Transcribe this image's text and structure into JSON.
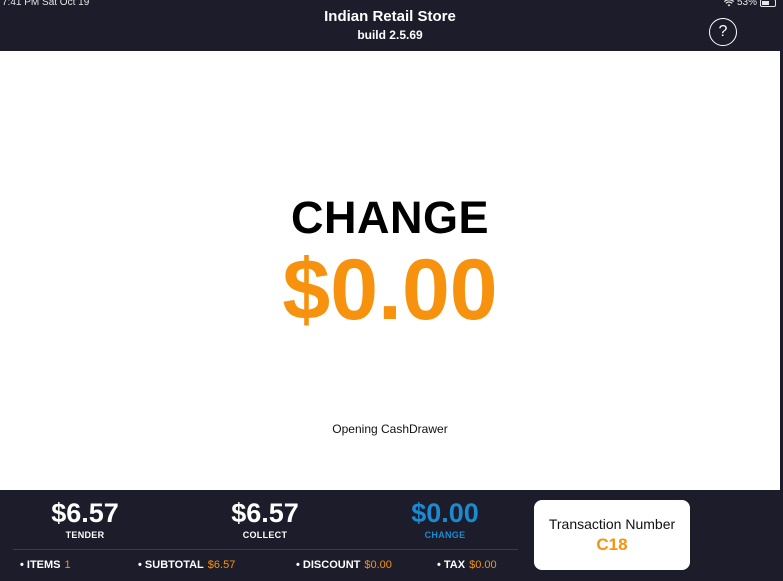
{
  "status_bar": {
    "time": "7:41 PM  Sat Oct 19",
    "battery": "53%"
  },
  "header": {
    "title": "Indian Retail Store",
    "subtitle": "build 2.5.69",
    "help_label": "?"
  },
  "main": {
    "heading": "CHANGE",
    "amount": "$0.00",
    "status_message": "Opening CashDrawer"
  },
  "footer": {
    "tender": {
      "value": "$6.57",
      "label": "TENDER"
    },
    "collect": {
      "value": "$6.57",
      "label": "COLLECT"
    },
    "change": {
      "value": "$0.00",
      "label": "CHANGE"
    },
    "summary": {
      "items_label": "• ITEMS",
      "items_value": "1",
      "subtotal_label": "• SUBTOTAL",
      "subtotal_value": "$6.57",
      "discount_label": "• DISCOUNT",
      "discount_value": "$0.00",
      "tax_label": "• TAX",
      "tax_value": "$0.00"
    },
    "transaction": {
      "label": "Transaction Number",
      "value": "C18"
    }
  },
  "colors": {
    "accent_orange": "#f7920e",
    "accent_blue": "#1a8ad1",
    "dark_bg": "#1c1c2b"
  }
}
